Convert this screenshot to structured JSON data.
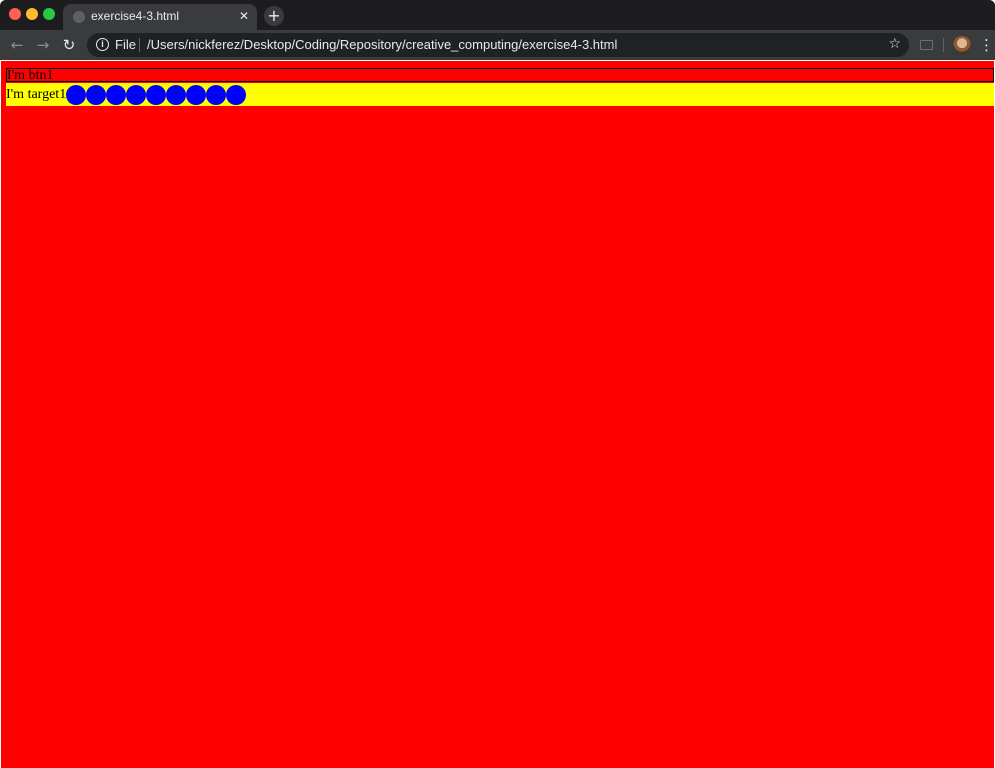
{
  "browser": {
    "tab": {
      "title": "exercise4-3.html",
      "close_glyph": "✕"
    },
    "new_tab_glyph": "+",
    "toolbar": {
      "back_glyph": "←",
      "forward_glyph": "→",
      "reload_glyph": "↻",
      "info_glyph": "i",
      "scheme_label": "File",
      "url": "/Users/nickferez/Desktop/Coding/Repository/creative_computing/exercise4-3.html",
      "star_glyph": "☆",
      "menu_glyph": "⋮"
    }
  },
  "page": {
    "background_color": "#ff0000",
    "btn1_text": "I'm btn1",
    "target1_text": "I'm target1",
    "target1_background": "#ffff00",
    "dot_color": "#0000ff",
    "dot_count": 9
  }
}
